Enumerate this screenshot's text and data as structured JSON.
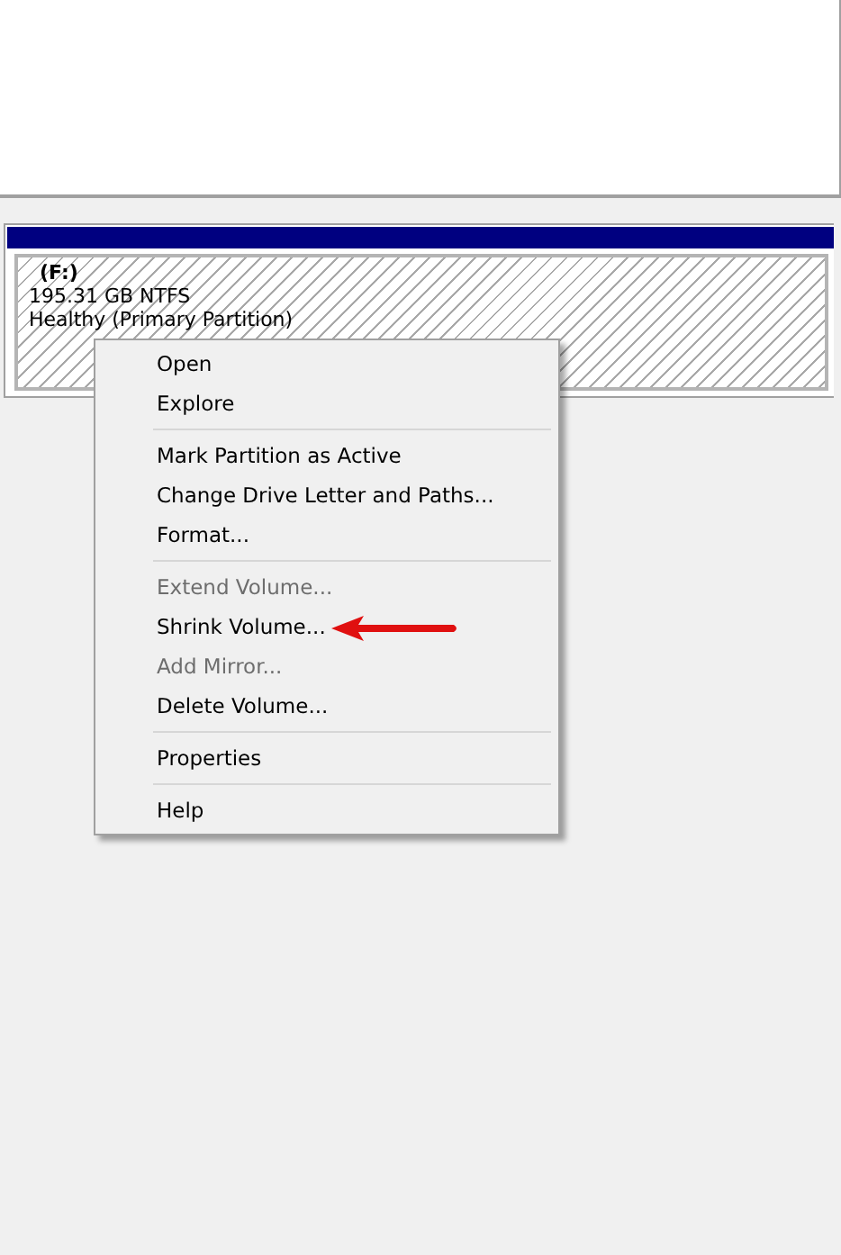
{
  "volume": {
    "label": "(F:)",
    "size": "195.31 GB NTFS",
    "status": "Healthy (Primary Partition)"
  },
  "context_menu": {
    "items": [
      {
        "kind": "item",
        "label": "Open",
        "disabled": false
      },
      {
        "kind": "item",
        "label": "Explore",
        "disabled": false
      },
      {
        "kind": "separator"
      },
      {
        "kind": "item",
        "label": "Mark Partition as Active",
        "disabled": false
      },
      {
        "kind": "item",
        "label": "Change Drive Letter and Paths...",
        "disabled": false
      },
      {
        "kind": "item",
        "label": "Format...",
        "disabled": false
      },
      {
        "kind": "separator"
      },
      {
        "kind": "item",
        "label": "Extend Volume...",
        "disabled": true
      },
      {
        "kind": "item",
        "label": "Shrink Volume...",
        "disabled": false,
        "highlighted": true
      },
      {
        "kind": "item",
        "label": "Add Mirror...",
        "disabled": true
      },
      {
        "kind": "item",
        "label": "Delete Volume...",
        "disabled": false
      },
      {
        "kind": "separator"
      },
      {
        "kind": "item",
        "label": "Properties",
        "disabled": false
      },
      {
        "kind": "separator"
      },
      {
        "kind": "item",
        "label": "Help",
        "disabled": false
      }
    ]
  }
}
